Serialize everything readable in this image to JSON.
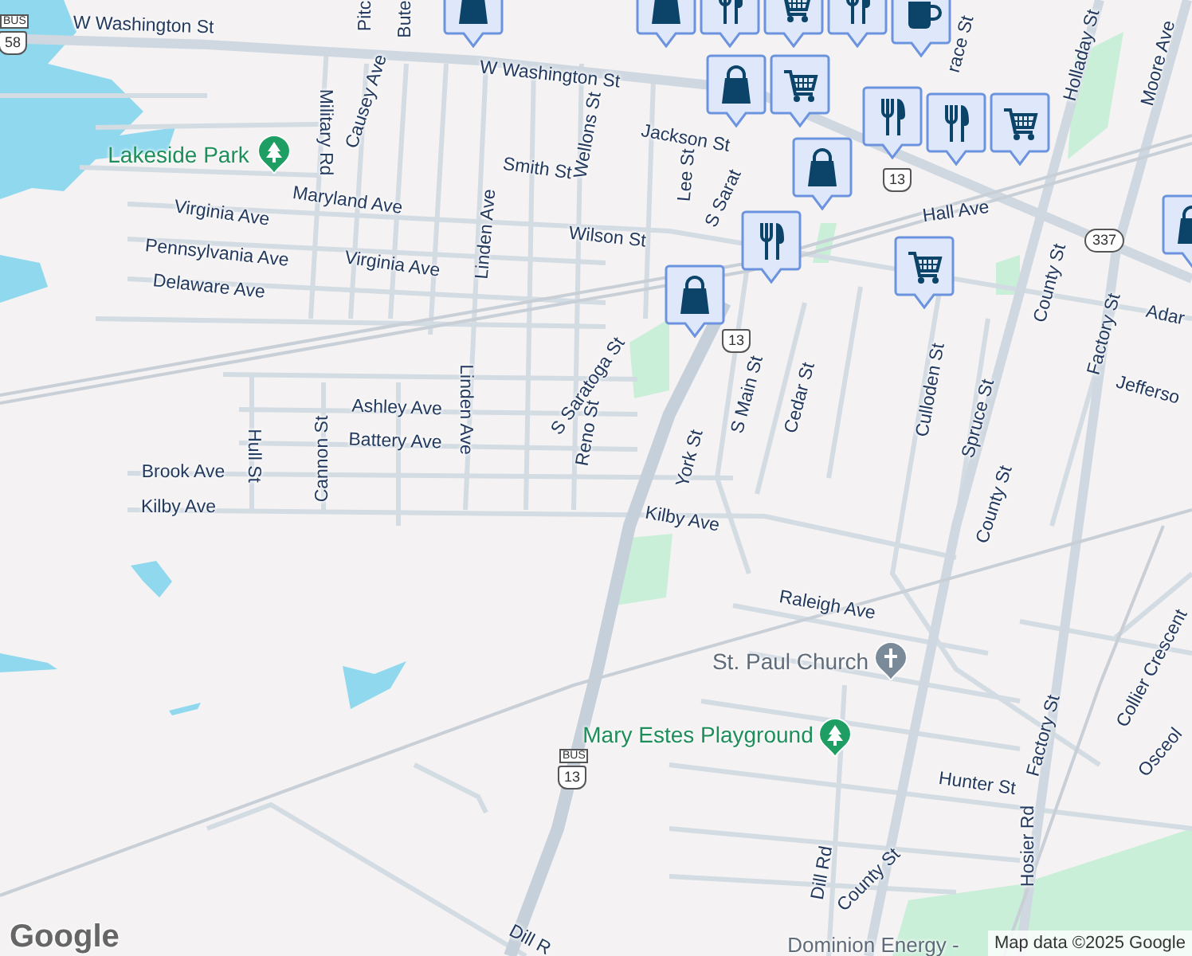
{
  "map": {
    "labels": [
      {
        "text": "W Washington St",
        "kind": "street"
      },
      {
        "text": "W Washington St",
        "kind": "street"
      },
      {
        "text": "Pitc",
        "kind": "street"
      },
      {
        "text": "Bute",
        "kind": "street"
      },
      {
        "text": "Lakeside Park",
        "kind": "park"
      },
      {
        "text": "Military Rd",
        "kind": "street"
      },
      {
        "text": "Causey Ave",
        "kind": "street"
      },
      {
        "text": "Smith St",
        "kind": "street"
      },
      {
        "text": "Wellons St",
        "kind": "street"
      },
      {
        "text": "Maryland Ave",
        "kind": "street"
      },
      {
        "text": "Virginia Ave",
        "kind": "street"
      },
      {
        "text": "Pennsylvania Ave",
        "kind": "street"
      },
      {
        "text": "Virginia Ave",
        "kind": "street"
      },
      {
        "text": "Delaware Ave",
        "kind": "street"
      },
      {
        "text": "Linden Ave",
        "kind": "street"
      },
      {
        "text": "Wilson St",
        "kind": "street"
      },
      {
        "text": "Jackson St",
        "kind": "street"
      },
      {
        "text": "Lee St",
        "kind": "street"
      },
      {
        "text": "S Sarat",
        "kind": "street"
      },
      {
        "text": "Hall Ave",
        "kind": "street"
      },
      {
        "text": "race St",
        "kind": "street"
      },
      {
        "text": "Holladay St",
        "kind": "street"
      },
      {
        "text": "Moore Ave",
        "kind": "street"
      },
      {
        "text": "County St",
        "kind": "street"
      },
      {
        "text": "Factory St",
        "kind": "street"
      },
      {
        "text": "Adar",
        "kind": "street"
      },
      {
        "text": "Jefferso",
        "kind": "street"
      },
      {
        "text": "Culloden St",
        "kind": "street"
      },
      {
        "text": "Spruce St",
        "kind": "street"
      },
      {
        "text": "Cedar St",
        "kind": "street"
      },
      {
        "text": "S Main St",
        "kind": "street"
      },
      {
        "text": "York St",
        "kind": "street"
      },
      {
        "text": "S Saratoga St",
        "kind": "street"
      },
      {
        "text": "Reno St",
        "kind": "street"
      },
      {
        "text": "Linden Ave",
        "kind": "street"
      },
      {
        "text": "Ashley Ave",
        "kind": "street"
      },
      {
        "text": "Battery Ave",
        "kind": "street"
      },
      {
        "text": "Hull St",
        "kind": "street"
      },
      {
        "text": "Cannon St",
        "kind": "street"
      },
      {
        "text": "Brook Ave",
        "kind": "street"
      },
      {
        "text": "Kilby Ave",
        "kind": "street"
      },
      {
        "text": "Kilby Ave",
        "kind": "street"
      },
      {
        "text": "County St",
        "kind": "street"
      },
      {
        "text": "Raleigh Ave",
        "kind": "street"
      },
      {
        "text": "St. Paul Church",
        "kind": "church"
      },
      {
        "text": "Mary Estes Playground",
        "kind": "park"
      },
      {
        "text": "Hunter St",
        "kind": "street"
      },
      {
        "text": "Factory St",
        "kind": "street"
      },
      {
        "text": "Collier Crescent",
        "kind": "street"
      },
      {
        "text": "Osceol",
        "kind": "street"
      },
      {
        "text": "Hosier Rd",
        "kind": "street"
      },
      {
        "text": "Dill Rd",
        "kind": "street"
      },
      {
        "text": "County St",
        "kind": "street"
      },
      {
        "text": "Dill R",
        "kind": "street"
      },
      {
        "text": "Dominion Energy -",
        "kind": "poi"
      }
    ],
    "shields": [
      {
        "text": "58",
        "kind": "us",
        "bus": "BUS"
      },
      {
        "text": "13",
        "kind": "us"
      },
      {
        "text": "13",
        "kind": "us"
      },
      {
        "text": "13",
        "kind": "us",
        "bus": "BUS"
      },
      {
        "text": "337",
        "kind": "state"
      }
    ],
    "pins": [
      {
        "kind": "shop"
      },
      {
        "kind": "shop"
      },
      {
        "kind": "restaurant"
      },
      {
        "kind": "grocery"
      },
      {
        "kind": "restaurant"
      },
      {
        "kind": "cafe"
      },
      {
        "kind": "shop"
      },
      {
        "kind": "grocery"
      },
      {
        "kind": "restaurant"
      },
      {
        "kind": "restaurant"
      },
      {
        "kind": "grocery"
      },
      {
        "kind": "shop"
      },
      {
        "kind": "restaurant"
      },
      {
        "kind": "shop"
      },
      {
        "kind": "grocery"
      },
      {
        "kind": "shop"
      }
    ],
    "logo": "Google",
    "attribution": "Map data ©2025 Google"
  }
}
